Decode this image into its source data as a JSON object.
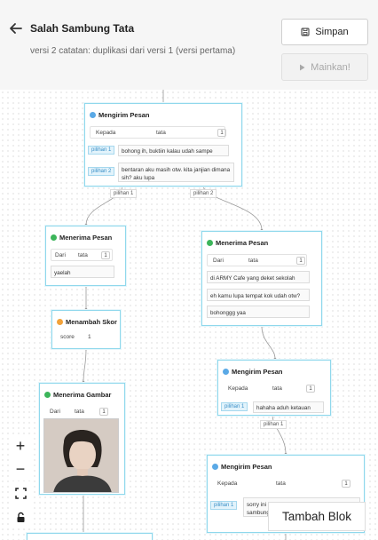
{
  "header": {
    "title": "Salah Sambung Tata",
    "subtitle": "versi 2 catatan: duplikasi dari versi 1 (versi pertama)",
    "save_label": "Simpan",
    "play_label": "Mainkan!"
  },
  "nodes": {
    "n1": {
      "title": "Mengirim Pesan",
      "to_label": "Kepada",
      "to_value": "tata",
      "to_num": "1",
      "opt1_tag": "pilihan 1",
      "opt1_text": "bohong ih, buktiin kalau udah sampe",
      "opt2_tag": "pilihan 2",
      "opt2_text": "bentaran aku masih otw. kita janjian dimana sih? aku lupa"
    },
    "n2": {
      "title": "Menerima Pesan",
      "from_label": "Dari",
      "from_value": "tata",
      "from_num": "1",
      "msg1": "yaelah"
    },
    "n3": {
      "title": "Menerima Pesan",
      "from_label": "Dari",
      "from_value": "tata",
      "from_num": "1",
      "msg1": "di ARMY Cafe yang deket sekolah",
      "msg2": "eh kamu lupa tempat kok udah otw?",
      "msg3": "bohonggg yaa"
    },
    "n4": {
      "title": "Menambah Skor",
      "score_label": "score",
      "score_value": "1"
    },
    "n5": {
      "title": "Menerima Gambar",
      "from_label": "Dari",
      "from_value": "tata",
      "from_num": "1"
    },
    "n6": {
      "title": "Mengirim Pesan",
      "to_label": "Kepada",
      "to_value": "tata",
      "to_num": "1",
      "opt1_tag": "pilihan 1",
      "opt1_text": "hahaha aduh ketauan"
    },
    "n7": {
      "title": "Mengirim Pesan",
      "to_label": "Kepada",
      "to_value": "tata",
      "to_num": "1",
      "opt1_tag": "pilihan 1",
      "opt1_text": "sorry ini bukan Eja, kayaknya salah sambung"
    }
  },
  "edge_labels": {
    "e1": "pilihan 1",
    "e2": "pilihan 2",
    "e3": "pilihan 1"
  },
  "controls": {
    "zoom_in": "+",
    "zoom_out": "−"
  },
  "add_block_label": "Tambah Blok",
  "colors": {
    "node_border": "#8fd8ec",
    "tag_bg": "#e2f3fb",
    "send_dot": "#5aa9e6",
    "receive_dot": "#3cb55a",
    "score_dot": "#f2a23a"
  }
}
